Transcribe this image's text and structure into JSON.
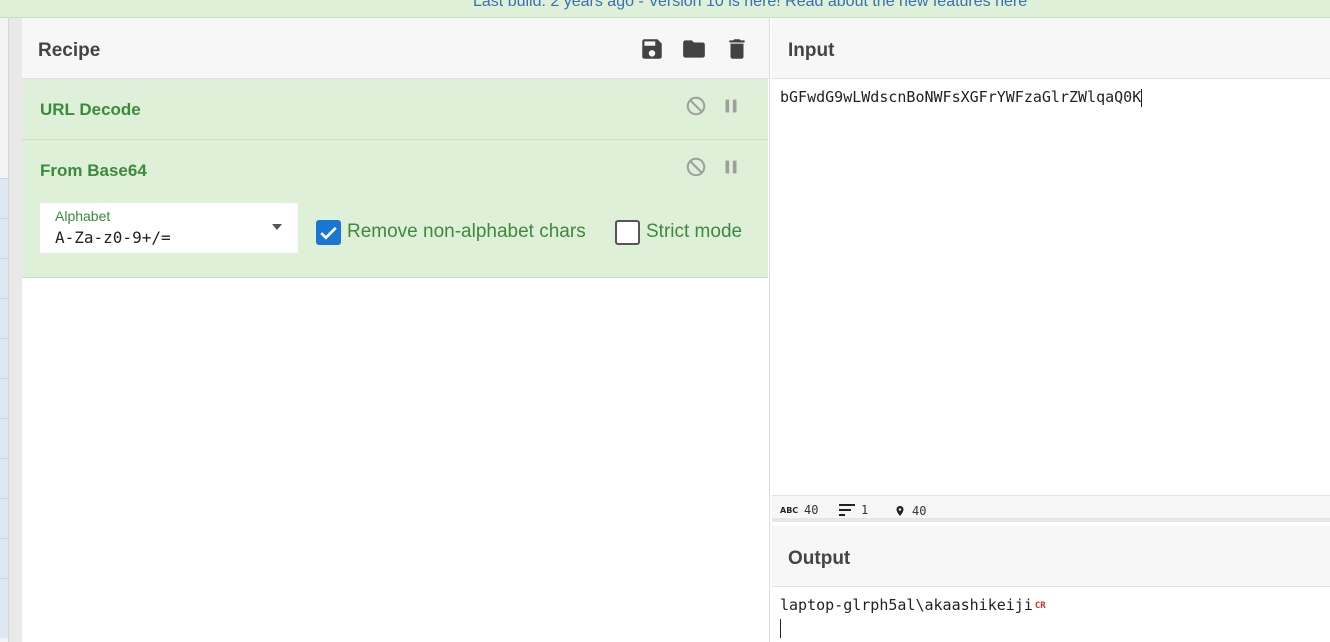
{
  "banner": {
    "text": "Last build: 2 years ago - Version 10 is here! Read about the new features ",
    "link": "here"
  },
  "recipe": {
    "title": "Recipe",
    "toolbar": {
      "save": "save-icon",
      "load": "folder-icon",
      "clear": "trash-icon"
    },
    "operations": [
      {
        "name": "URL Decode"
      },
      {
        "name": "From Base64",
        "alphabet": {
          "label": "Alphabet",
          "value": "A-Za-z0-9+/="
        },
        "remove_non_alphabet": {
          "label": "Remove non-alphabet chars",
          "checked": true
        },
        "strict_mode": {
          "label": "Strict mode",
          "checked": false
        }
      }
    ]
  },
  "input": {
    "title": "Input",
    "value": "bGFwdG9wLWdscnBoNWFsXGFrYWFzaGlrZWlqaQ0K",
    "stats": {
      "chars": "40",
      "lines": "1",
      "position": "40"
    }
  },
  "output": {
    "title": "Output",
    "value": "laptop-glrph5al\\akaashikeiji",
    "cr_marker": "CR"
  },
  "colors": {
    "op_bg": "#dff0d8",
    "op_text": "#3c8a3c",
    "checkbox": "#1976d2",
    "banner_link": "#3a6fb0"
  }
}
